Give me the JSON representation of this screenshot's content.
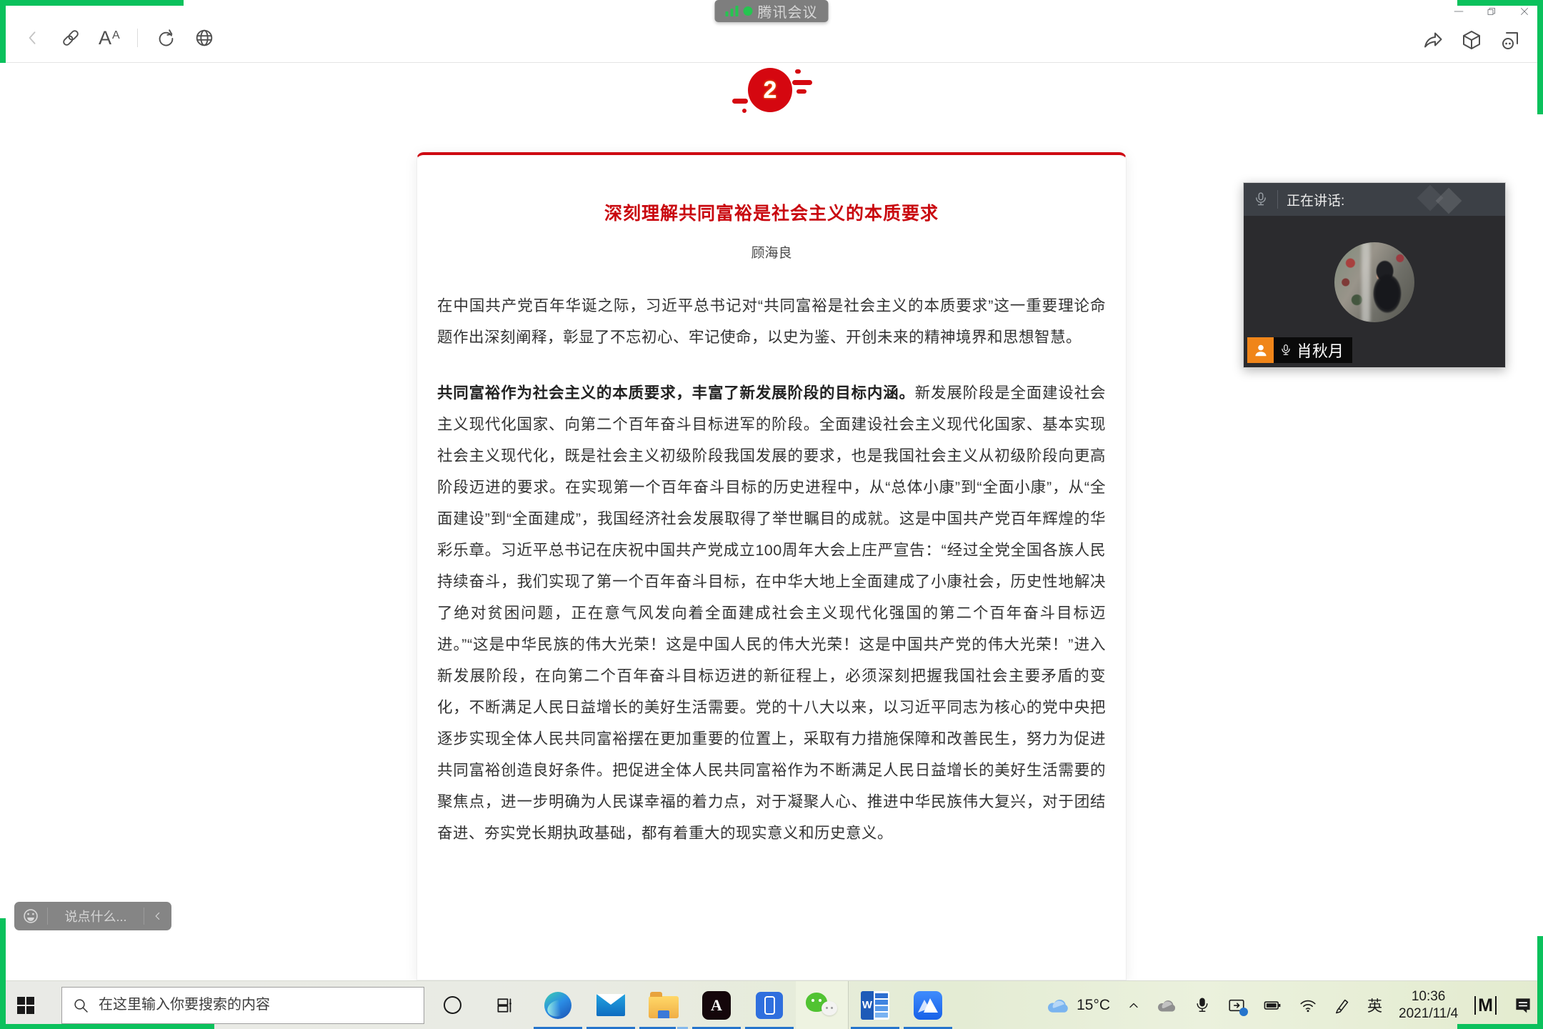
{
  "pill": {
    "label": "腾讯会议"
  },
  "badge": {
    "number": "2"
  },
  "article": {
    "title": "深刻理解共同富裕是社会主义的本质要求",
    "author": "顾海良",
    "p1": "在中国共产党百年华诞之际，习近平总书记对“共同富裕是社会主义的本质要求”这一重要理论命题作出深刻阐释，彰显了不忘初心、牢记使命，以史为鉴、开创未来的精神境界和思想智慧。",
    "p2_lead": "共同富裕作为社会主义的本质要求，丰富了新发展阶段的目标内涵。",
    "p2_rest": "新发展阶段是全面建设社会主义现代化国家、向第二个百年奋斗目标进军的阶段。全面建设社会主义现代化国家、基本实现社会主义现代化，既是社会主义初级阶段我国发展的要求，也是我国社会主义从初级阶段向更高阶段迈进的要求。在实现第一个百年奋斗目标的历史进程中，从“总体小康”到“全面小康”，从“全面建设”到“全面建成”，我国经济社会发展取得了举世瞩目的成就。这是中国共产党百年辉煌的华彩乐章。习近平总书记在庆祝中国共产党成立100周年大会上庄严宣告：“经过全党全国各族人民持续奋斗，我们实现了第一个百年奋斗目标，在中华大地上全面建成了小康社会，历史性地解决了绝对贫困问题，正在意气风发向着全面建成社会主义现代化强国的第二个百年奋斗目标迈进。”“这是中华民族的伟大光荣！这是中国人民的伟大光荣！这是中国共产党的伟大光荣！”进入新发展阶段，在向第二个百年奋斗目标迈进的新征程上，必须深刻把握我国社会主要矛盾的变化，不断满足人民日益增长的美好生活需要。党的十八大以来，以习近平同志为核心的党中央把逐步实现全体人民共同富裕摆在更加重要的位置上，采取有力措施保障和改善民生，努力为促进共同富裕创造良好条件。把促进全体人民共同富裕作为不断满足人民日益增长的美好生活需要的聚焦点，进一步明确为人民谋幸福的着力点，对于凝聚人心、推进中华民族伟大复兴，对于团结奋进、夯实党长期执政基础，都有着重大的现实意义和历史意义。"
  },
  "meeting": {
    "speaking_label": "正在讲话:",
    "participant_name": "肖秋月",
    "chat_placeholder": "说点什么..."
  },
  "taskbar": {
    "search_placeholder": "在这里输入你要搜索的内容",
    "weather_temp": "15°C",
    "language_indicator": "英",
    "clock": {
      "time": "10:36",
      "date": "2021/11/4"
    },
    "apps": [
      "cortana",
      "task-view",
      "edge",
      "mail",
      "file-explorer",
      "acrobat",
      "your-phone",
      "wechat",
      "word",
      "tencent-meeting"
    ]
  },
  "icons": {
    "font_tool_big": "A",
    "font_tool_small": "A",
    "word_letter": "W",
    "acrobat_letter": "A",
    "m_logo": "M"
  },
  "colors": {
    "accent_red": "#ce0812",
    "share_green": "#0bc15c",
    "taskbar_underline": "#2574cc",
    "host_badge_orange": "#f08519"
  }
}
